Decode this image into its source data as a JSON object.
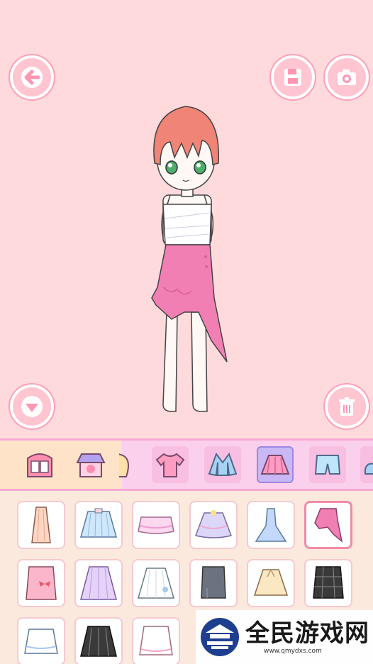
{
  "top_buttons": {
    "back": "arrow-left-icon",
    "save": "floppy-disk-icon",
    "camera": "camera-icon"
  },
  "side_buttons": {
    "collapse": "triangle-down-icon",
    "delete": "trash-icon"
  },
  "colors": {
    "background": "#ffdadd",
    "button_fill": "#ffc6d2",
    "category_bar": "#fbd0ec",
    "selected_category": "#c9b8f5",
    "skirt_pink": "#f27fb4"
  },
  "categories": [
    {
      "name": "wardrobe",
      "icon": "wardrobe-icon"
    },
    {
      "name": "shop",
      "icon": "shop-icon"
    },
    {
      "name": "hair",
      "icon": "hair-icon"
    },
    {
      "name": "top",
      "icon": "tshirt-icon"
    },
    {
      "name": "jacket",
      "icon": "jacket-icon"
    },
    {
      "name": "skirt",
      "icon": "skirt-icon",
      "selected": true
    },
    {
      "name": "shorts",
      "icon": "shorts-icon"
    },
    {
      "name": "shoes",
      "icon": "shoe-icon"
    }
  ],
  "items": [
    {
      "icon": "long-peach-skirt-icon"
    },
    {
      "icon": "blue-pleated-skirt-icon"
    },
    {
      "icon": "pink-tutu-skirt-icon"
    },
    {
      "icon": "lace-tutu-skirt-icon"
    },
    {
      "icon": "blue-mermaid-skirt-icon"
    },
    {
      "icon": "pink-asymmetric-skirt-icon",
      "selected": true
    },
    {
      "icon": "pink-bow-skirt-icon"
    },
    {
      "icon": "lilac-skirt-icon"
    },
    {
      "icon": "white-flower-skirt-icon"
    },
    {
      "icon": "gray-pencil-skirt-icon"
    },
    {
      "icon": "cream-ribbon-skirt-icon"
    },
    {
      "icon": "plaid-skirt-icon"
    },
    {
      "icon": "white-frill-skirt-icon"
    },
    {
      "icon": "black-pleated-skirt-icon"
    },
    {
      "icon": "white-pink-skirt-icon"
    }
  ],
  "watermark": {
    "title": "全民游戏网",
    "url": "www.qmydxs.com"
  }
}
